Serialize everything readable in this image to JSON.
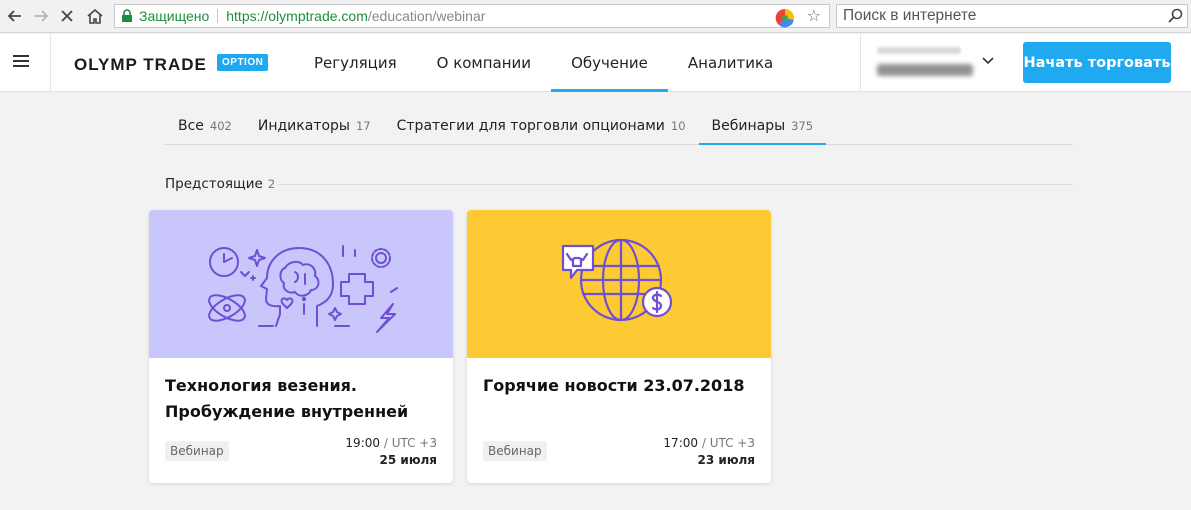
{
  "browser": {
    "secure_label": "Защищено",
    "url_host": "https://olymptrade.com",
    "url_path": "/education/webinar",
    "search_placeholder": "Поиск в интернете"
  },
  "header": {
    "logo": "OLYMP TRADE",
    "logo_badge": "OPTION",
    "nav": [
      {
        "label": "Регуляция"
      },
      {
        "label": "О компании"
      },
      {
        "label": "Обучение",
        "active": true
      },
      {
        "label": "Аналитика"
      }
    ],
    "cta_label": "Начать торговать"
  },
  "filters": [
    {
      "label": "Все",
      "count": "402"
    },
    {
      "label": "Индикаторы",
      "count": "17"
    },
    {
      "label": "Стратегии для торговли опционами",
      "count": "10"
    },
    {
      "label": "Вебинары",
      "count": "375",
      "active": true
    }
  ],
  "section": {
    "title": "Предстоящие",
    "count": "2"
  },
  "cards": [
    {
      "title": "Технология везения. Пробуждение внутренней",
      "tag": "Вебинар",
      "time": "19:00",
      "timezone": "/ UTC +3",
      "date": "25 июля",
      "bg_color": "#c8c6fa",
      "icon": "brain-head-illustration"
    },
    {
      "title": "Горячие новости 23.07.2018",
      "tag": "Вебинар",
      "time": "17:00",
      "timezone": "/ UTC +3",
      "date": "23 июля",
      "bg_color": "#fdca33",
      "icon": "globe-bull-dollar-illustration"
    }
  ],
  "colors": {
    "accent": "#1da8f0",
    "illustration_stroke": "#6f4fd6"
  }
}
